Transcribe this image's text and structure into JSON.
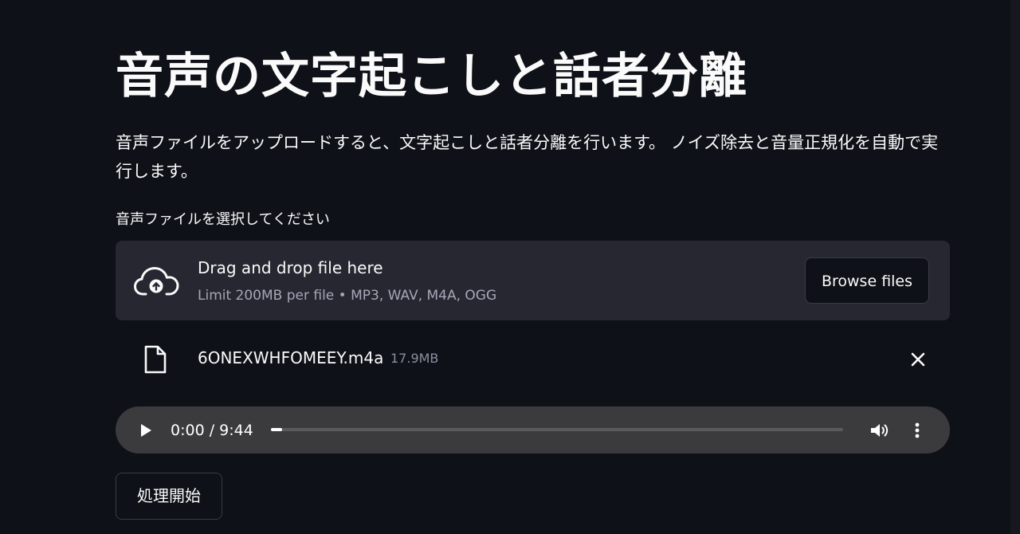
{
  "header": {
    "title": "音声の文字起こしと話者分離",
    "description": "音声ファイルをアップロードすると、文字起こしと話者分離を行います。 ノイズ除去と音量正規化を自動で実行します。"
  },
  "uploader": {
    "label": "音声ファイルを選択してください",
    "drop_title": "Drag and drop file here",
    "limit_text": "Limit 200MB per file • MP3, WAV, M4A, OGG",
    "browse_label": "Browse files",
    "upload_icon": "cloud-upload-icon"
  },
  "uploaded_file": {
    "name": "6ONEXWHFOMEEY.m4a",
    "size": "17.9MB",
    "file_icon": "file-icon",
    "remove_icon": "close-icon"
  },
  "audio_player": {
    "time": "0:00 / 9:44",
    "progress_fraction": 0.0,
    "play_icon": "play-icon",
    "volume_icon": "volume-icon",
    "more_icon": "more-vertical-icon"
  },
  "actions": {
    "process_label": "処理開始"
  },
  "colors": {
    "background": "#0e1117",
    "surface": "#262730",
    "player": "#3b3b3d",
    "text": "#fafafa",
    "muted_text": "#a3a8b8"
  }
}
